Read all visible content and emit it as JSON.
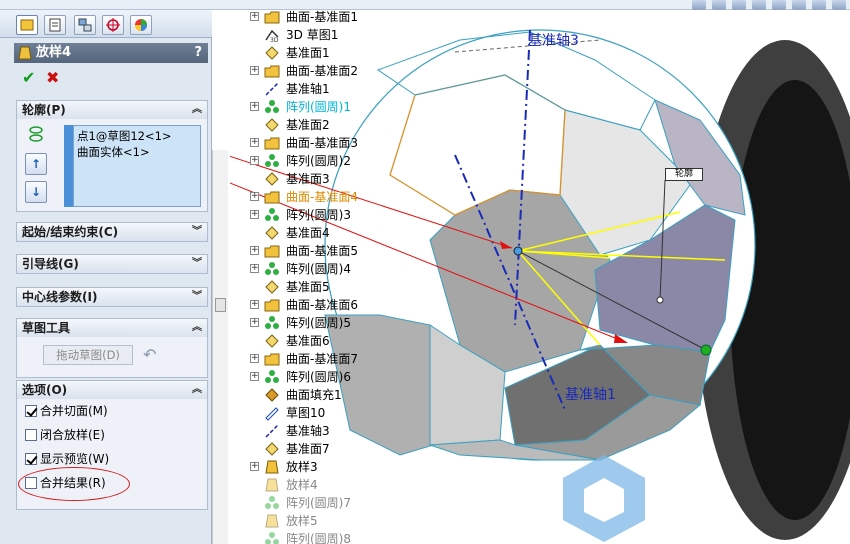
{
  "top_right_icons": [
    "zoom-fit-icon",
    "zoom-area-icon",
    "previous-view-icon",
    "section-view-icon",
    "view-orientation-icon",
    "display-style-icon",
    "hide-show-icon",
    "appearance-icon"
  ],
  "property_manager": {
    "title": "放样4",
    "help": "?",
    "ok_icon": "check-icon",
    "cancel_icon": "close-icon",
    "profile_group": {
      "header": "轮廓(P)",
      "items": [
        "点1@草图12<1>",
        "曲面实体<1>"
      ],
      "up_label": "↑",
      "down_label": "↓"
    },
    "start_end_header": "起始/结束约束(C)",
    "guides_header": "引导线(G)",
    "centerline_header": "中心线参数(I)",
    "sketch_tools": {
      "header": "草图工具",
      "drag_label": "拖动草图(D)"
    },
    "options": {
      "header": "选项(O)",
      "items": [
        {
          "label": "合并切面(M)",
          "checked": true
        },
        {
          "label": "闭合放样(E)",
          "checked": false
        },
        {
          "label": "显示预览(W)",
          "checked": true
        },
        {
          "label": "合并结果(R)",
          "checked": false
        }
      ]
    }
  },
  "tree": [
    {
      "label": "曲面-基准面1",
      "icon": "surface-folder-icon",
      "expand": "+",
      "style": ""
    },
    {
      "label": "3D 草图1",
      "icon": "3d-sketch-icon",
      "expand": "",
      "style": ""
    },
    {
      "label": "基准面1",
      "icon": "plane-icon",
      "expand": "",
      "style": ""
    },
    {
      "label": "曲面-基准面2",
      "icon": "surface-folder-icon",
      "expand": "+",
      "style": ""
    },
    {
      "label": "基准轴1",
      "icon": "axis-icon",
      "expand": "",
      "style": ""
    },
    {
      "label": "阵列(圆周)1",
      "icon": "circular-pattern-icon",
      "expand": "+",
      "style": "hl-cyan"
    },
    {
      "label": "基准面2",
      "icon": "plane-icon",
      "expand": "",
      "style": ""
    },
    {
      "label": "曲面-基准面3",
      "icon": "surface-folder-icon",
      "expand": "+",
      "style": ""
    },
    {
      "label": "阵列(圆周)2",
      "icon": "circular-pattern-icon",
      "expand": "+",
      "style": ""
    },
    {
      "label": "基准面3",
      "icon": "plane-icon",
      "expand": "",
      "style": ""
    },
    {
      "label": "曲面-基准面4",
      "icon": "surface-folder-icon",
      "expand": "+",
      "style": "hl-orange"
    },
    {
      "label": "阵列(圆周)3",
      "icon": "circular-pattern-icon",
      "expand": "+",
      "style": ""
    },
    {
      "label": "基准面4",
      "icon": "plane-icon",
      "expand": "",
      "style": ""
    },
    {
      "label": "曲面-基准面5",
      "icon": "surface-folder-icon",
      "expand": "+",
      "style": ""
    },
    {
      "label": "阵列(圆周)4",
      "icon": "circular-pattern-icon",
      "expand": "+",
      "style": ""
    },
    {
      "label": "基准面5",
      "icon": "plane-icon",
      "expand": "",
      "style": ""
    },
    {
      "label": "曲面-基准面6",
      "icon": "surface-folder-icon",
      "expand": "+",
      "style": ""
    },
    {
      "label": "阵列(圆周)5",
      "icon": "circular-pattern-icon",
      "expand": "+",
      "style": ""
    },
    {
      "label": "基准面6",
      "icon": "plane-icon",
      "expand": "",
      "style": ""
    },
    {
      "label": "曲面-基准面7",
      "icon": "surface-folder-icon",
      "expand": "+",
      "style": ""
    },
    {
      "label": "阵列(圆周)6",
      "icon": "circular-pattern-icon",
      "expand": "+",
      "style": ""
    },
    {
      "label": "曲面填充1",
      "icon": "surface-fill-icon",
      "expand": "",
      "style": ""
    },
    {
      "label": "草图10",
      "icon": "sketch-icon",
      "expand": "",
      "style": ""
    },
    {
      "label": "基准轴3",
      "icon": "axis-icon",
      "expand": "",
      "style": ""
    },
    {
      "label": "基准面7",
      "icon": "plane-icon",
      "expand": "",
      "style": ""
    },
    {
      "label": "放样3",
      "icon": "loft-icon",
      "expand": "+",
      "style": ""
    },
    {
      "label": "放样4",
      "icon": "loft-icon",
      "expand": "",
      "style": "dim"
    },
    {
      "label": "阵列(圆周)7",
      "icon": "circular-pattern-icon",
      "expand": "",
      "style": "dim"
    },
    {
      "label": "放样5",
      "icon": "loft-icon",
      "expand": "",
      "style": "dim"
    },
    {
      "label": "阵列(圆周)8",
      "icon": "circular-pattern-icon",
      "expand": "",
      "style": "dim"
    }
  ],
  "viewport": {
    "axis_top_label": "基准轴3",
    "axis_bottom_label": "基准轴1",
    "profile_tag": "轮廓"
  }
}
